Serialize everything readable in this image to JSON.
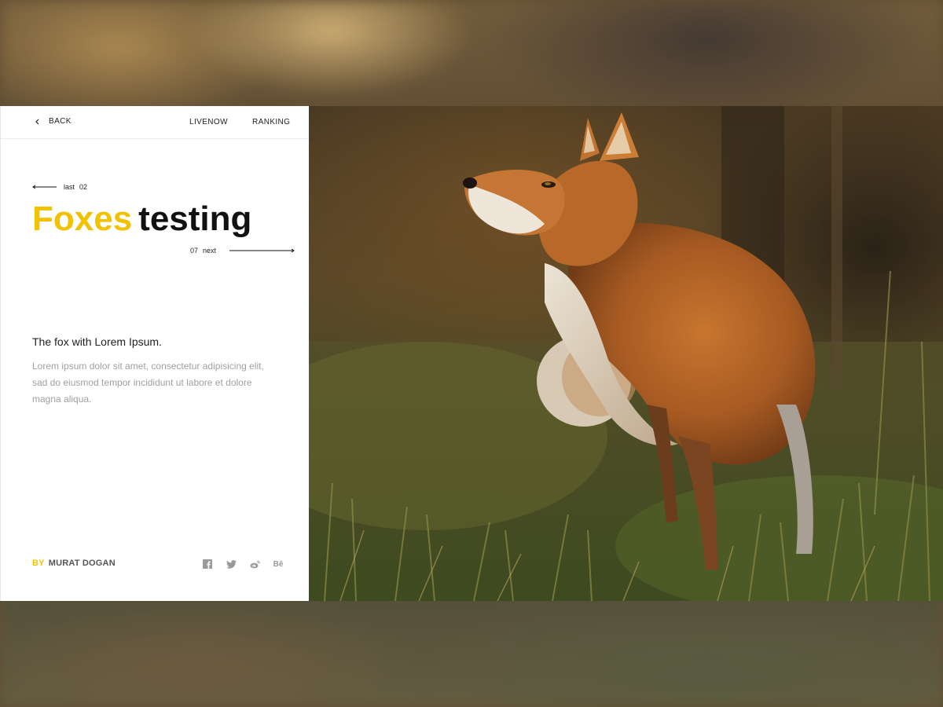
{
  "nav": {
    "back_label": "BACK",
    "livenow_label": "LIVENOW",
    "ranking_label": "RANKING"
  },
  "article": {
    "prev_label": "last",
    "prev_number": "02",
    "title_highlight": "Foxes",
    "title_rest": "testing",
    "next_number": "07",
    "next_label": "next",
    "subheading": "The fox with Lorem Ipsum.",
    "body": "Lorem ipsum dolor sit amet, consectetur adipisicing elit, sad do eiusmod tempor incididunt ut labore et dolore magna aliqua."
  },
  "footer": {
    "by_label": "BY",
    "author": "MURAT DOGAN",
    "socials": [
      "facebook-icon",
      "twitter-icon",
      "weibo-icon",
      "behance-icon"
    ],
    "behance_text": "Bē"
  },
  "colors": {
    "accent": "#f2c200",
    "text": "#111111",
    "muted": "#a0a0a0",
    "panel": "#ffffff"
  }
}
